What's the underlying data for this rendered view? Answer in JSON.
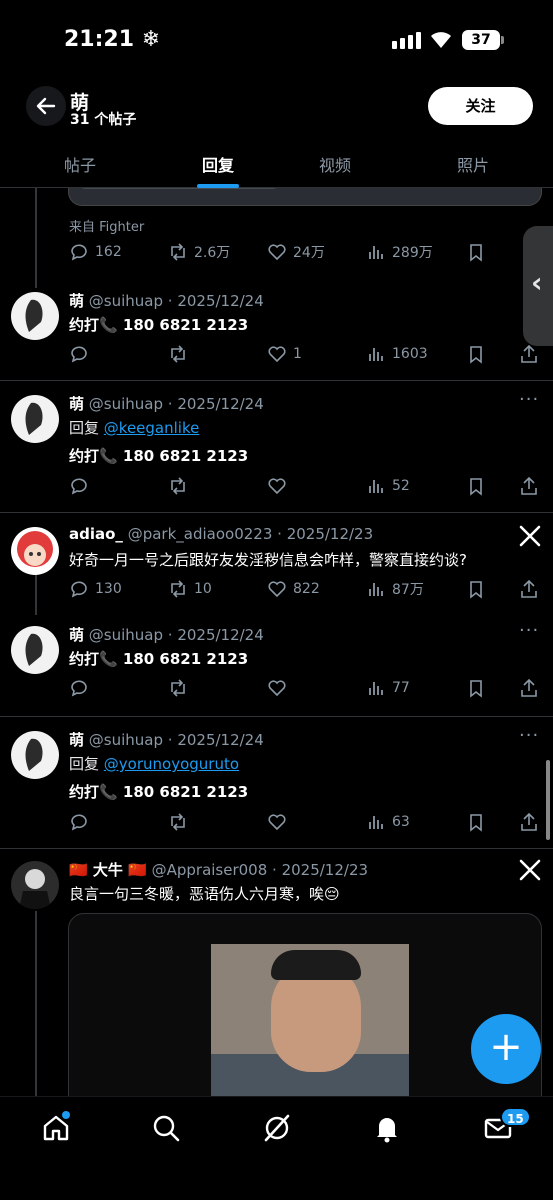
{
  "status_bar": {
    "time": "21:21 ❄",
    "battery": "37"
  },
  "header": {
    "title": "萌",
    "subtitle": "31 个帖子",
    "follow_label": "关注"
  },
  "tabs": [
    {
      "label": "帖子"
    },
    {
      "label": "回复"
    },
    {
      "label": "视频"
    },
    {
      "label": "照片"
    }
  ],
  "top_post": {
    "source": "来自 Fighter",
    "replies": "162",
    "reposts": "2.6万",
    "likes": "24万",
    "views": "289万"
  },
  "posts": [
    {
      "name": "萌",
      "handle": "@suihuap · 2025/12/24",
      "text": "约打📞 180 6821 2123",
      "replies": "",
      "reposts": "",
      "likes": "1",
      "views": "1603"
    },
    {
      "name": "萌",
      "handle": "@suihuap · 2025/12/24",
      "reply_prefix": "回复",
      "reply_to": "@keeganlike",
      "text": "约打📞 180 6821 2123",
      "views": "52"
    },
    {
      "name": "adiao_",
      "handle": "@park_adiaoo0223 · 2025/12/23",
      "text": "好奇一月一号之后跟好友发淫秽信息会咋样，警察直接约谈?",
      "replies": "130",
      "reposts": "10",
      "likes": "822",
      "views": "87万"
    },
    {
      "name": "萌",
      "handle": "@suihuap · 2025/12/24",
      "text": "约打📞 180 6821 2123",
      "views": "77"
    },
    {
      "name": "萌",
      "handle": "@suihuap · 2025/12/24",
      "reply_prefix": "回复",
      "reply_to": "@yorunoyoguruto",
      "text": "约打📞 180 6821 2123",
      "views": "63"
    },
    {
      "name": "🇨🇳 大牛 🇨🇳",
      "handle": "@Appraiser008 · 2025/12/23",
      "text": "良言一句三冬暖，恶语伤人六月寒，唉😔"
    }
  ],
  "fab_label": "+",
  "bottom_nav": {
    "messages_badge": "15"
  },
  "colors": {
    "accent": "#1d9bf0",
    "background": "#000000",
    "muted": "#8b98a5"
  }
}
